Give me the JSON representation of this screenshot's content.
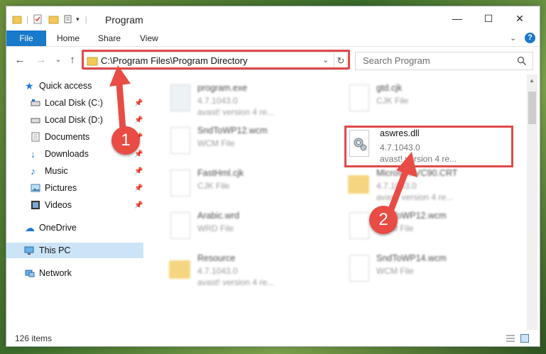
{
  "window": {
    "title": "Program"
  },
  "ribbon": {
    "tabs": [
      "File",
      "Home",
      "Share",
      "View"
    ]
  },
  "address": {
    "path": "C:\\Program Files\\Program Directory"
  },
  "search": {
    "placeholder": "Search Program"
  },
  "nav": {
    "items": [
      {
        "label": "Quick access",
        "icon": "star-icon",
        "pinned": false
      },
      {
        "label": "Local Disk (C:)",
        "icon": "drive-icon",
        "pinned": true
      },
      {
        "label": "Local Disk (D:)",
        "icon": "drive-icon",
        "pinned": true
      },
      {
        "label": "Documents",
        "icon": "documents-icon",
        "pinned": true
      },
      {
        "label": "Downloads",
        "icon": "download-icon",
        "pinned": true
      },
      {
        "label": "Music",
        "icon": "music-icon",
        "pinned": true
      },
      {
        "label": "Pictures",
        "icon": "pictures-icon",
        "pinned": true
      },
      {
        "label": "Videos",
        "icon": "videos-icon",
        "pinned": true
      },
      {
        "label": "OneDrive",
        "icon": "cloud-icon",
        "pinned": false
      },
      {
        "label": "This PC",
        "icon": "computer-icon",
        "pinned": false,
        "selected": true
      },
      {
        "label": "Network",
        "icon": "network-icon",
        "pinned": false
      }
    ]
  },
  "files": [
    {
      "name": "program.exe",
      "line1": "4.7.1043.0",
      "line2": "avast! version 4 re...",
      "kind": "exe"
    },
    {
      "name": "gtd.cjk",
      "line1": "CJK File",
      "line2": "",
      "kind": "doc"
    },
    {
      "name": "SndToWP12.wcm",
      "line1": "WCM File",
      "line2": "",
      "kind": "doc"
    },
    {
      "name": "aswres.dll",
      "line1": "4.7.1043.0",
      "line2": "avast! version 4 re...",
      "kind": "dll"
    },
    {
      "name": "FastHml.cjk",
      "line1": "CJK File",
      "line2": "",
      "kind": "doc"
    },
    {
      "name": "Microsoft.VC90.CRT",
      "line1": "4.7.1043.0",
      "line2": "avast! version 4 re...",
      "kind": "folder"
    },
    {
      "name": "Arabic.wrd",
      "line1": "WRD File",
      "line2": "",
      "kind": "doc"
    },
    {
      "name": "SndToWP12.wcm",
      "line1": "WCM File",
      "line2": "",
      "kind": "doc"
    },
    {
      "name": "Resource",
      "line1": "4.7.1043.0",
      "line2": "avast! version 4 re...",
      "kind": "folder"
    },
    {
      "name": "SndToWP14.wcm",
      "line1": "WCM File",
      "line2": "",
      "kind": "doc"
    }
  ],
  "annotations": {
    "step1": "1",
    "step2": "2"
  },
  "status": {
    "item_count": "126 items"
  },
  "colors": {
    "accent": "#1979ca",
    "highlight": "#e04a4a"
  }
}
